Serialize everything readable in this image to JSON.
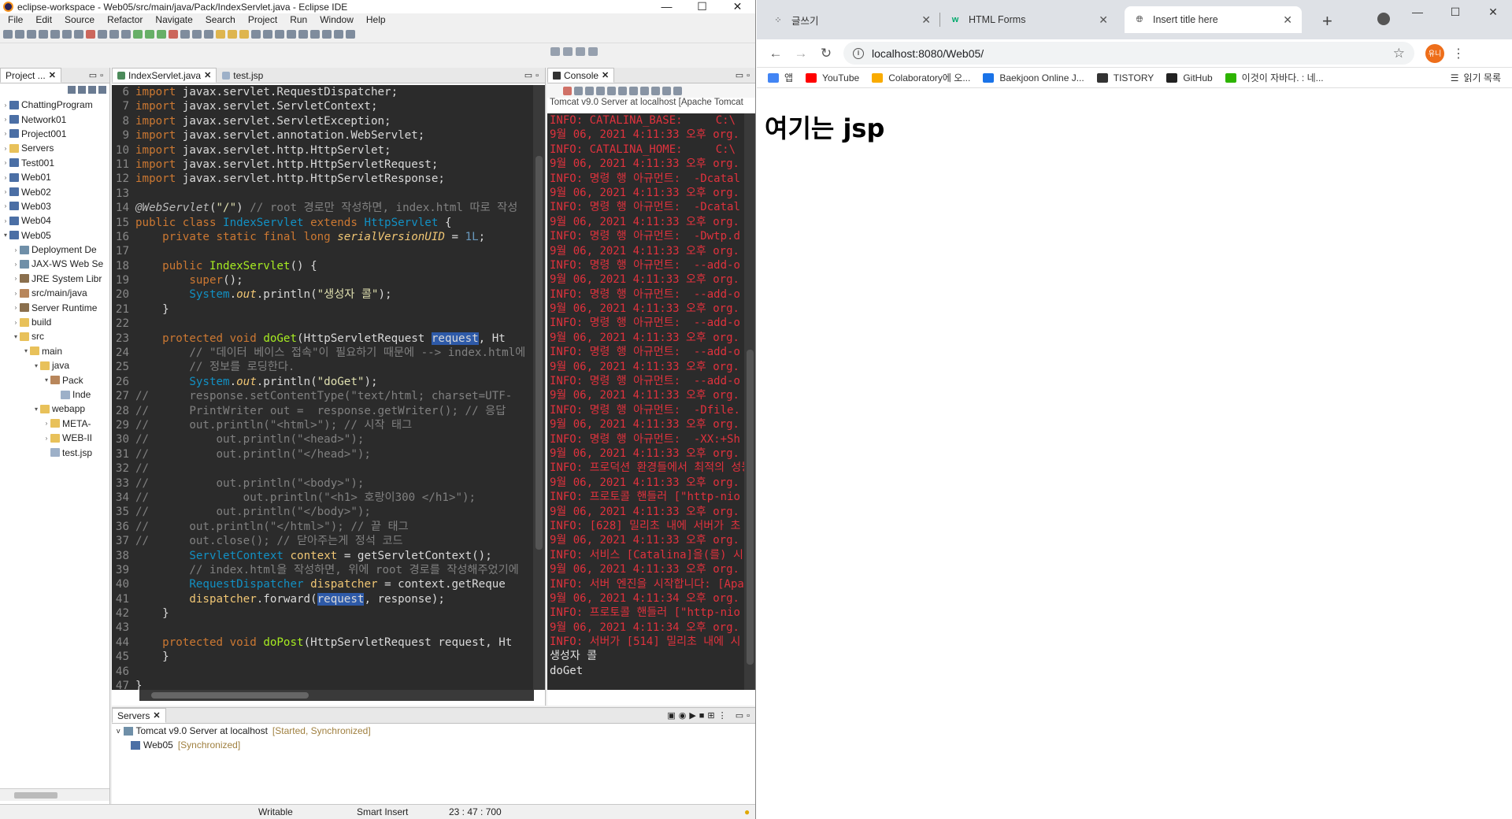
{
  "eclipse": {
    "title": "eclipse-workspace - Web05/src/main/java/Pack/IndexServlet.java - Eclipse IDE",
    "menu": [
      "File",
      "Edit",
      "Source",
      "Refactor",
      "Navigate",
      "Search",
      "Project",
      "Run",
      "Window",
      "Help"
    ],
    "project_explorer": {
      "tab_label": "Project ...",
      "items": [
        {
          "label": "ChattingProgram",
          "depth": 0,
          "icon": "project-icon",
          "arrow": ">"
        },
        {
          "label": "Network01",
          "depth": 0,
          "icon": "project-icon",
          "arrow": ">"
        },
        {
          "label": "Project001",
          "depth": 0,
          "icon": "project-icon",
          "arrow": ">"
        },
        {
          "label": "Servers",
          "depth": 0,
          "icon": "folder-icon",
          "arrow": ">"
        },
        {
          "label": "Test001",
          "depth": 0,
          "icon": "project-icon",
          "arrow": ">"
        },
        {
          "label": "Web01",
          "depth": 0,
          "icon": "project-icon",
          "arrow": ">"
        },
        {
          "label": "Web02",
          "depth": 0,
          "icon": "project-icon",
          "arrow": ">"
        },
        {
          "label": "Web03",
          "depth": 0,
          "icon": "project-icon",
          "arrow": ">"
        },
        {
          "label": "Web04",
          "depth": 0,
          "icon": "project-icon",
          "arrow": ">"
        },
        {
          "label": "Web05",
          "depth": 0,
          "icon": "project-icon",
          "arrow": "v"
        },
        {
          "label": "Deployment De",
          "depth": 1,
          "icon": "server-icon",
          "arrow": ">"
        },
        {
          "label": "JAX-WS Web Se",
          "depth": 1,
          "icon": "server-icon",
          "arrow": ">"
        },
        {
          "label": "JRE System Libr",
          "depth": 1,
          "icon": "library-icon",
          "arrow": ">"
        },
        {
          "label": "src/main/java",
          "depth": 1,
          "icon": "package-icon",
          "arrow": ">"
        },
        {
          "label": "Server Runtime",
          "depth": 1,
          "icon": "library-icon",
          "arrow": ">"
        },
        {
          "label": "build",
          "depth": 1,
          "icon": "folder-icon",
          "arrow": ">"
        },
        {
          "label": "src",
          "depth": 1,
          "icon": "folder-icon",
          "arrow": "v"
        },
        {
          "label": "main",
          "depth": 2,
          "icon": "folder-icon",
          "arrow": "v"
        },
        {
          "label": "java",
          "depth": 3,
          "icon": "folder-icon",
          "arrow": "v"
        },
        {
          "label": "Pack",
          "depth": 4,
          "icon": "package-icon",
          "arrow": "v"
        },
        {
          "label": "Inde",
          "depth": 5,
          "icon": "file-icon",
          "arrow": ""
        },
        {
          "label": "webapp",
          "depth": 3,
          "icon": "folder-icon",
          "arrow": "v"
        },
        {
          "label": "META-",
          "depth": 4,
          "icon": "folder-icon",
          "arrow": ">"
        },
        {
          "label": "WEB-II",
          "depth": 4,
          "icon": "folder-icon",
          "arrow": ">"
        },
        {
          "label": "test.jsp",
          "depth": 4,
          "icon": "file-icon",
          "arrow": ""
        }
      ]
    },
    "editor": {
      "tabs": [
        {
          "label": "IndexServlet.java",
          "active": true
        },
        {
          "label": "test.jsp",
          "active": false
        }
      ]
    },
    "console": {
      "tab_label": "Console",
      "title": "Tomcat v9.0 Server at localhost [Apache Tomcat",
      "lines": [
        {
          "t": "INFO: CATALINA_BASE:     C:\\",
          "ok": false
        },
        {
          "t": "9월 06, 2021 4:11:33 오후 org.",
          "ok": false
        },
        {
          "t": "INFO: CATALINA_HOME:     C:\\",
          "ok": false
        },
        {
          "t": "9월 06, 2021 4:11:33 오후 org.",
          "ok": false
        },
        {
          "t": "INFO: 명령 행 아규먼트:  -Dcatal",
          "ok": false
        },
        {
          "t": "9월 06, 2021 4:11:33 오후 org.",
          "ok": false
        },
        {
          "t": "INFO: 명령 행 아규먼트:  -Dcatal",
          "ok": false
        },
        {
          "t": "9월 06, 2021 4:11:33 오후 org.",
          "ok": false
        },
        {
          "t": "INFO: 명령 행 아규먼트:  -Dwtp.d",
          "ok": false
        },
        {
          "t": "9월 06, 2021 4:11:33 오후 org.",
          "ok": false
        },
        {
          "t": "INFO: 명령 행 아규먼트:  --add-o",
          "ok": false
        },
        {
          "t": "9월 06, 2021 4:11:33 오후 org.",
          "ok": false
        },
        {
          "t": "INFO: 명령 행 아규먼트:  --add-o",
          "ok": false
        },
        {
          "t": "9월 06, 2021 4:11:33 오후 org.",
          "ok": false
        },
        {
          "t": "INFO: 명령 행 아규먼트:  --add-o",
          "ok": false
        },
        {
          "t": "9월 06, 2021 4:11:33 오후 org.",
          "ok": false
        },
        {
          "t": "INFO: 명령 행 아규먼트:  --add-o",
          "ok": false
        },
        {
          "t": "9월 06, 2021 4:11:33 오후 org.",
          "ok": false
        },
        {
          "t": "INFO: 명령 행 아규먼트:  --add-o",
          "ok": false
        },
        {
          "t": "9월 06, 2021 4:11:33 오후 org.",
          "ok": false
        },
        {
          "t": "INFO: 명령 행 아규먼트:  -Dfile.",
          "ok": false
        },
        {
          "t": "9월 06, 2021 4:11:33 오후 org.",
          "ok": false
        },
        {
          "t": "INFO: 명령 행 아규먼트:  -XX:+Sh",
          "ok": false
        },
        {
          "t": "9월 06, 2021 4:11:33 오후 org.",
          "ok": false
        },
        {
          "t": "INFO: 프로덕션 환경들에서 최적의 성능",
          "ok": false
        },
        {
          "t": "9월 06, 2021 4:11:33 오후 org.",
          "ok": false
        },
        {
          "t": "INFO: 프로토콜 핸들러 [\"http-nio",
          "ok": false
        },
        {
          "t": "9월 06, 2021 4:11:33 오후 org.",
          "ok": false
        },
        {
          "t": "INFO: [628] 밀리초 내에 서버가 초",
          "ok": false
        },
        {
          "t": "9월 06, 2021 4:11:33 오후 org.",
          "ok": false
        },
        {
          "t": "INFO: 서비스 [Catalina]을(를) 시",
          "ok": false
        },
        {
          "t": "9월 06, 2021 4:11:33 오후 org.",
          "ok": false
        },
        {
          "t": "INFO: 서버 엔진을 시작합니다: [Apa",
          "ok": false
        },
        {
          "t": "9월 06, 2021 4:11:34 오후 org.",
          "ok": false
        },
        {
          "t": "INFO: 프로토콜 핸들러 [\"http-nio",
          "ok": false
        },
        {
          "t": "9월 06, 2021 4:11:34 오후 org.",
          "ok": false
        },
        {
          "t": "INFO: 서버가 [514] 밀리초 내에 시",
          "ok": false
        },
        {
          "t": "생성자 콜",
          "ok": true
        },
        {
          "t": "doGet",
          "ok": true
        }
      ]
    },
    "servers": {
      "tab_label": "Servers",
      "server_name": "Tomcat v9.0 Server at localhost",
      "server_state": "[Started, Synchronized]",
      "module_name": "Web05",
      "module_state": "[Synchronized]"
    },
    "status": {
      "mode": "Writable",
      "insert": "Smart Insert",
      "position": "23 : 47 : 700"
    }
  },
  "chrome": {
    "tabs": [
      {
        "label": "글쓰기",
        "icon": "tistory-icon",
        "active": false
      },
      {
        "label": "HTML Forms",
        "icon": "w3schools-icon",
        "active": false
      },
      {
        "label": "Insert title here",
        "icon": "globe-icon",
        "active": true
      }
    ],
    "url": "localhost:8080/Web05/",
    "avatar_text": "유니",
    "bookmarks": [
      {
        "label": "앱",
        "color": "#4285f4"
      },
      {
        "label": "YouTube",
        "color": "#ff0000"
      },
      {
        "label": "Colaboratory에 오...",
        "color": "#f9ab00"
      },
      {
        "label": "Baekjoon Online J...",
        "color": "#1a73e8"
      },
      {
        "label": "TISTORY",
        "color": "#333333"
      },
      {
        "label": "GitHub",
        "color": "#222222"
      },
      {
        "label": "이것이 자바다. : 네...",
        "color": "#2db400"
      }
    ],
    "reading_list": "읽기 목록",
    "page_heading": "여기는 jsp"
  }
}
